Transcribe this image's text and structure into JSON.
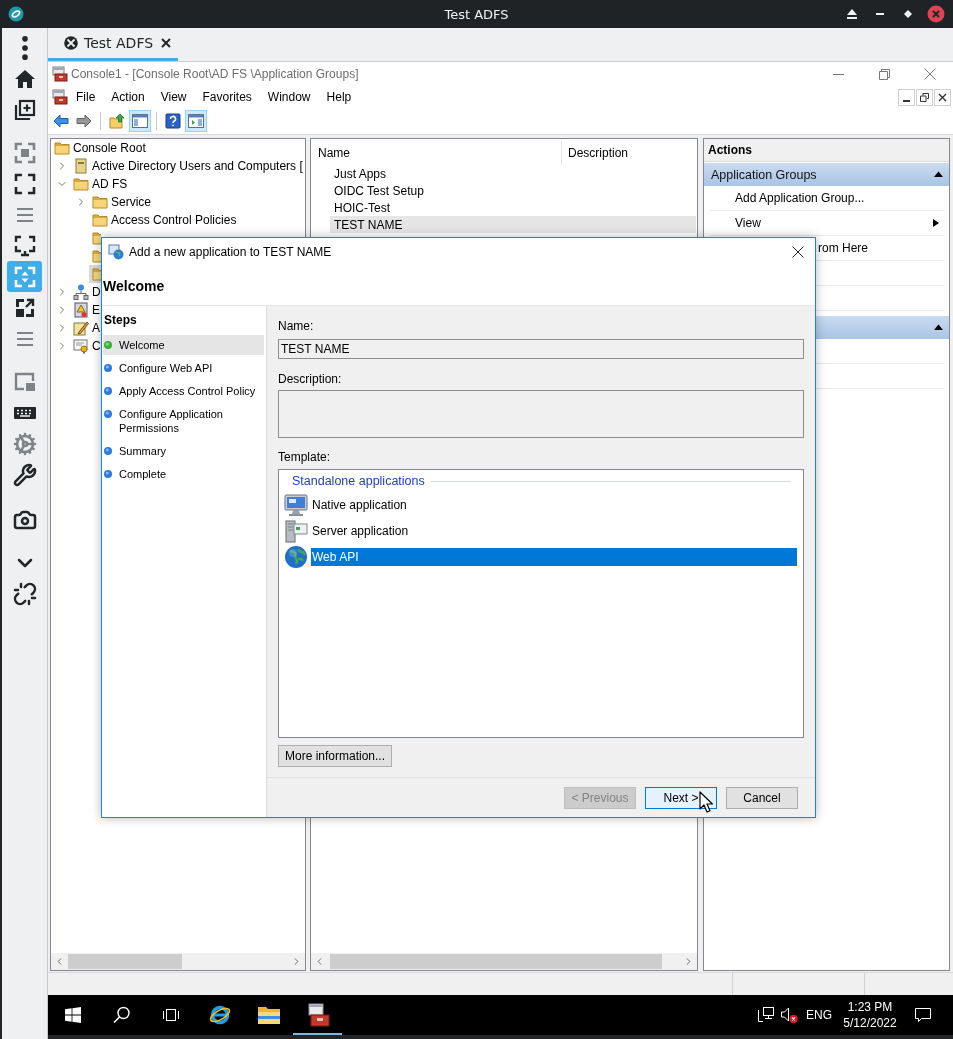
{
  "app_window": {
    "title": "Test ADFS"
  },
  "sidebar": {
    "buttons": [
      {
        "selected": false,
        "disabled": false
      },
      {
        "selected": false,
        "disabled": false
      },
      {
        "selected": false,
        "disabled": false
      },
      {
        "selected": false,
        "disabled": true
      },
      {
        "selected": false,
        "disabled": false
      },
      {
        "selected": false,
        "disabled": true
      },
      {
        "selected": false,
        "disabled": false
      },
      {
        "selected": true,
        "disabled": false
      },
      {
        "selected": false,
        "disabled": false
      },
      {
        "selected": false,
        "disabled": true
      },
      {
        "selected": false,
        "disabled": true
      },
      {
        "selected": false,
        "disabled": false
      },
      {
        "selected": false,
        "disabled": true
      },
      {
        "selected": false,
        "disabled": false
      },
      {
        "selected": false,
        "disabled": false
      },
      {
        "selected": false,
        "disabled": false
      },
      {
        "selected": false,
        "disabled": false
      }
    ]
  },
  "tabs": [
    {
      "label": "Test ADFS",
      "selected": true
    }
  ],
  "console": {
    "title": "Console1 - [Console Root\\AD FS \\Application Groups]",
    "menu": [
      "File",
      "Action",
      "View",
      "Favorites",
      "Window",
      "Help"
    ],
    "toolbar": [
      {
        "pressed": false,
        "disabled": false
      },
      {
        "pressed": false,
        "disabled": true
      },
      {
        "pressed": false,
        "disabled": false
      },
      {
        "pressed": true,
        "disabled": false
      },
      {
        "pressed": false,
        "disabled": false
      },
      {
        "pressed": true,
        "disabled": false
      }
    ],
    "tree": [
      {
        "label": "Console Root",
        "kind": "folder",
        "selected": false,
        "children": [
          {
            "label": "Active Directory Users and Computers [",
            "kind": "snapin",
            "expanded": false,
            "selected": false
          },
          {
            "label": "AD FS",
            "kind": "folder",
            "expanded": true,
            "selected": false,
            "children": [
              {
                "label": "Service",
                "kind": "folder",
                "expanded": false,
                "selected": false
              },
              {
                "label": "Access Control Policies",
                "kind": "folder",
                "selected": false
              },
              {
                "kind": "folder",
                "selected": false
              },
              {
                "kind": "folder",
                "selected": false
              },
              {
                "kind": "folder",
                "selected": true
              }
            ]
          },
          {
            "label": "D",
            "kind": "snapin",
            "expanded": false,
            "selected": false
          },
          {
            "label": "E",
            "kind": "snapin",
            "expanded": false,
            "selected": false
          },
          {
            "label": "A",
            "kind": "snapin",
            "expanded": false,
            "selected": false
          },
          {
            "label": "C",
            "kind": "snapin",
            "expanded": false,
            "selected": false
          }
        ]
      }
    ],
    "list": {
      "columns": [
        "Name",
        "Description"
      ],
      "rows": [
        {
          "name": "Just Apps",
          "selected": false
        },
        {
          "name": "OIDC Test Setup",
          "selected": false
        },
        {
          "name": "HOIC-Test",
          "selected": false
        },
        {
          "name": "TEST NAME",
          "selected": true
        }
      ]
    },
    "actions": {
      "title": "Actions",
      "sections": [
        {
          "title": "Application Groups",
          "expanded": true,
          "items": [
            {
              "kind": "command",
              "label": "Add Application Group..."
            },
            {
              "kind": "submenu",
              "label": "View"
            },
            {
              "kind": "covered",
              "label": "rom Here"
            },
            {
              "kind": "blank"
            },
            {
              "kind": "blank"
            }
          ]
        },
        {
          "expanded": true,
          "items": [
            {
              "kind": "blank"
            },
            {
              "kind": "blank"
            }
          ]
        }
      ]
    }
  },
  "dialog": {
    "title": "Add a new application to TEST NAME",
    "heading": "Welcome",
    "steps_title": "Steps",
    "steps": [
      {
        "label": "Welcome",
        "selected": true
      },
      {
        "label": "Configure Web API",
        "selected": false
      },
      {
        "label": "Apply Access Control Policy",
        "selected": false
      },
      {
        "label": "Configure Application Permissions",
        "selected": false
      },
      {
        "label": "Summary",
        "selected": false
      },
      {
        "label": "Complete",
        "selected": false
      }
    ],
    "name": {
      "label": "Name:",
      "value": "TEST NAME"
    },
    "description": {
      "label": "Description:"
    },
    "template": {
      "label": "Template:",
      "group": "Standalone applications",
      "items": [
        {
          "label": "Native application",
          "selected": false
        },
        {
          "label": "Server application",
          "selected": false
        },
        {
          "label": "Web API",
          "selected": true
        }
      ]
    },
    "more_info": "More information...",
    "buttons": [
      {
        "label": "< Previous",
        "disabled": true,
        "default": false
      },
      {
        "label": "Next >",
        "disabled": false,
        "default": true
      },
      {
        "label": "Cancel",
        "disabled": false,
        "default": false
      }
    ]
  },
  "taskbar": {
    "apps": [
      {
        "active": false
      },
      {
        "active": false
      },
      {
        "active": true
      }
    ],
    "language": "ENG",
    "time": "1:23 PM",
    "date": "5/12/2022"
  }
}
